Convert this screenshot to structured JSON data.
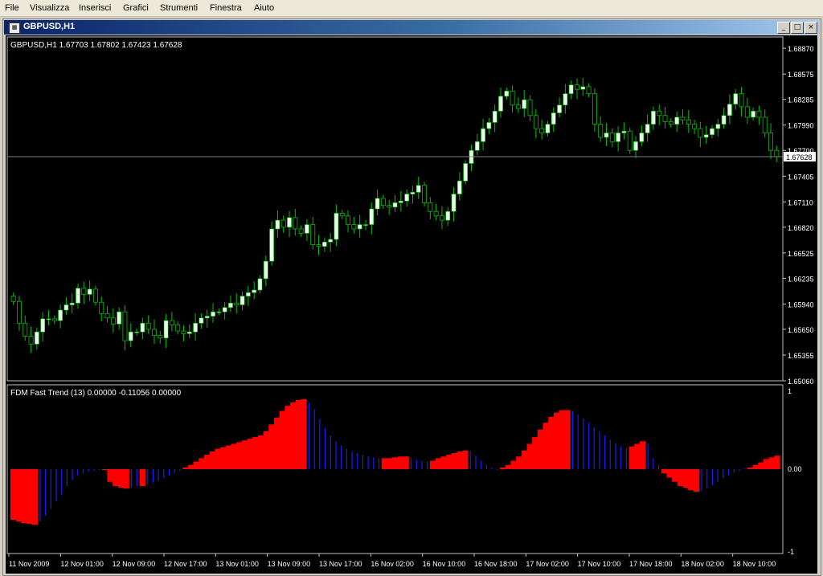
{
  "menu": {
    "items": [
      {
        "label": "File"
      },
      {
        "label": "Visualizza"
      },
      {
        "label": "Inserisci"
      },
      {
        "label": "Grafici"
      },
      {
        "label": "Strumenti"
      },
      {
        "label": "Finestra"
      },
      {
        "label": "Aiuto"
      }
    ]
  },
  "window": {
    "title": "GBPUSD,H1",
    "icon_name": "chart-window-icon",
    "minimize_glyph": "_",
    "restore_glyph": "□",
    "close_glyph": "×"
  },
  "colors": {
    "background": "#000000",
    "bull_candle": "#e8ffe8",
    "candle_wick": "#00c000",
    "hist_positive": "#ff0000",
    "hist_negative": "#1a1aff",
    "axis_text": "#ffffff",
    "price_line": "#808080"
  },
  "chart_data": [
    {
      "type": "candlestick",
      "title": "GBPUSD,H1  1.67703 1.67802 1.67423 1.67628",
      "current_price_label": "1.67628",
      "current_price": 1.67628,
      "ylim": [
        1.6506,
        1.69
      ],
      "y_ticks": [
        "1.68870",
        "1.68575",
        "1.68285",
        "1.67990",
        "1.67700",
        "1.67405",
        "1.67110",
        "1.66820",
        "1.66525",
        "1.66235",
        "1.65940",
        "1.65650",
        "1.65355",
        "1.65060"
      ],
      "y_tick_values": [
        1.6887,
        1.68575,
        1.68285,
        1.6799,
        1.677,
        1.67405,
        1.6711,
        1.6682,
        1.66525,
        1.66235,
        1.6594,
        1.6565,
        1.65355,
        1.6506
      ],
      "closes": [
        1.6597,
        1.6572,
        1.6557,
        1.6548,
        1.6562,
        1.6577,
        1.6577,
        1.6575,
        1.6587,
        1.6593,
        1.6595,
        1.6612,
        1.6605,
        1.6611,
        1.6596,
        1.6583,
        1.6578,
        1.6571,
        1.6585,
        1.6552,
        1.6562,
        1.6562,
        1.6572,
        1.6565,
        1.6558,
        1.6555,
        1.6575,
        1.657,
        1.6563,
        1.656,
        1.6562,
        1.6572,
        1.6578,
        1.658,
        1.6585,
        1.6585,
        1.659,
        1.6595,
        1.6593,
        1.6603,
        1.6607,
        1.661,
        1.6623,
        1.6643,
        1.668,
        1.669,
        1.6682,
        1.6693,
        1.668,
        1.6675,
        1.6685,
        1.6662,
        1.666,
        1.6665,
        1.6668,
        1.6698,
        1.6695,
        1.6685,
        1.668,
        1.6685,
        1.6685,
        1.6703,
        1.6715,
        1.6707,
        1.6705,
        1.671,
        1.6712,
        1.672,
        1.6722,
        1.673,
        1.671,
        1.67,
        1.6695,
        1.669,
        1.67,
        1.672,
        1.6735,
        1.6755,
        1.677,
        1.678,
        1.6795,
        1.6802,
        1.6815,
        1.6832,
        1.6838,
        1.6822,
        1.6818,
        1.6828,
        1.681,
        1.6795,
        1.679,
        1.68,
        1.6813,
        1.6822,
        1.6835,
        1.6845,
        1.684,
        1.6843,
        1.6835,
        1.68,
        1.6785,
        1.679,
        1.678,
        1.679,
        1.6792,
        1.677,
        1.678,
        1.679,
        1.68,
        1.6815,
        1.681,
        1.6803,
        1.68,
        1.6808,
        1.6805,
        1.68,
        1.6795,
        1.6785,
        1.6788,
        1.6795,
        1.68,
        1.681,
        1.6823,
        1.6835,
        1.682,
        1.6808,
        1.6815,
        1.6808,
        1.679,
        1.677,
        1.6763
      ],
      "x_ticks": [
        "11 Nov 2009",
        "12 Nov 01:00",
        "12 Nov 09:00",
        "12 Nov 17:00",
        "13 Nov 01:00",
        "13 Nov 09:00",
        "13 Nov 17:00",
        "16 Nov 02:00",
        "16 Nov 10:00",
        "16 Nov 18:00",
        "17 Nov 02:00",
        "17 Nov 10:00",
        "17 Nov 18:00",
        "18 Nov 02:00",
        "18 Nov 10:00"
      ]
    },
    {
      "type": "bar",
      "title": "FDM Fast Trend (13) 0.00000 -0.11056 0.00000",
      "ylim": [
        -1,
        1
      ],
      "y_ticks": [
        "1",
        "0.00",
        "-1"
      ],
      "y_tick_values": [
        1,
        0,
        -1
      ],
      "values": [
        -0.6,
        -0.62,
        -0.64,
        -0.65,
        -0.66,
        -0.62,
        -0.55,
        -0.47,
        -0.38,
        -0.3,
        -0.2,
        -0.13,
        -0.08,
        -0.05,
        -0.03,
        -0.02,
        -0.01,
        -0.01,
        -0.15,
        -0.2,
        -0.22,
        -0.23,
        -0.22,
        -0.2,
        -0.2,
        -0.18,
        -0.16,
        -0.14,
        -0.11,
        -0.08,
        -0.05,
        -0.02,
        0.02,
        0.05,
        0.09,
        0.13,
        0.17,
        0.21,
        0.24,
        0.26,
        0.28,
        0.3,
        0.32,
        0.34,
        0.36,
        0.38,
        0.4,
        0.45,
        0.53,
        0.61,
        0.69,
        0.75,
        0.79,
        0.82,
        0.83,
        0.79,
        0.71,
        0.6,
        0.49,
        0.4,
        0.33,
        0.28,
        0.24,
        0.21,
        0.19,
        0.17,
        0.15,
        0.14,
        0.13,
        0.13,
        0.13,
        0.14,
        0.15,
        0.15,
        0.13,
        0.11,
        0.1,
        0.09,
        0.1,
        0.13,
        0.15,
        0.17,
        0.19,
        0.21,
        0.22,
        0.21,
        0.16,
        0.1,
        0.05,
        0.02,
        -0.01,
        0.02,
        0.05,
        0.1,
        0.15,
        0.22,
        0.3,
        0.38,
        0.47,
        0.55,
        0.62,
        0.67,
        0.7,
        0.7,
        0.69,
        0.65,
        0.6,
        0.55,
        0.5,
        0.45,
        0.4,
        0.35,
        0.31,
        0.27,
        0.25,
        0.27,
        0.3,
        0.33,
        0.3,
        0.13,
        0.05,
        -0.05,
        -0.1,
        -0.15,
        -0.2,
        -0.22,
        -0.25,
        -0.27,
        -0.26,
        -0.23,
        -0.19,
        -0.15,
        -0.11,
        -0.07,
        -0.04,
        -0.02,
        0.01,
        0.02,
        0.05,
        0.08,
        0.12,
        0.14,
        0.16
      ],
      "positive_color_series": "red",
      "falling_color_series": "blue"
    }
  ]
}
